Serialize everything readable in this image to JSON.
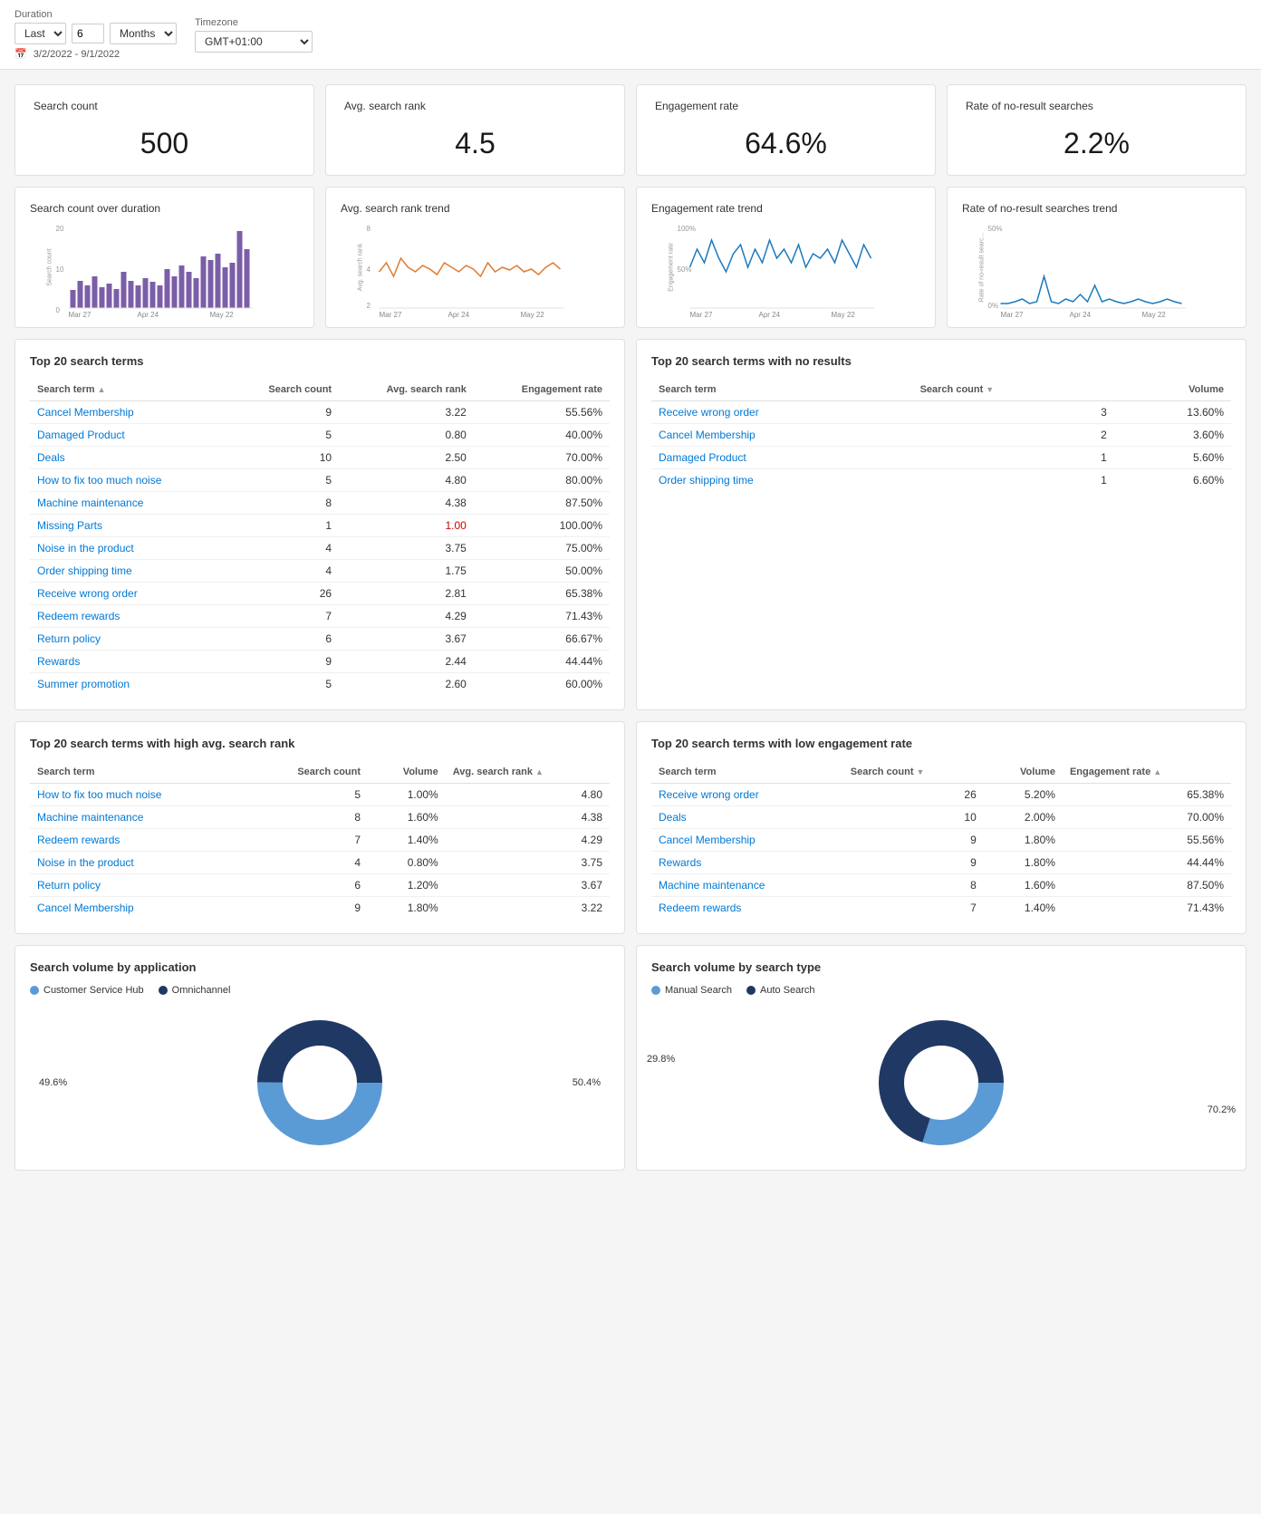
{
  "topBar": {
    "durationLabel": "Duration",
    "durationPreset": "Last",
    "durationValue": "6",
    "durationUnit": "Months",
    "timezoneLabel": "Timezone",
    "timezoneValue": "GMT+01:00",
    "dateRange": "3/2/2022 - 9/1/2022"
  },
  "metrics": [
    {
      "title": "Search count",
      "value": "500"
    },
    {
      "title": "Avg. search rank",
      "value": "4.5"
    },
    {
      "title": "Engagement rate",
      "value": "64.6%"
    },
    {
      "title": "Rate of no-result searches",
      "value": "2.2%"
    }
  ],
  "trendCharts": [
    {
      "title": "Search count over duration",
      "yLabel": "Search count",
      "xLabels": [
        "Mar 27",
        "Apr 24",
        "May 22"
      ]
    },
    {
      "title": "Avg. search rank trend",
      "yLabel": "Avg. search rank",
      "xLabels": [
        "Mar 27",
        "Apr 24",
        "May 22"
      ]
    },
    {
      "title": "Engagement rate trend",
      "yLabel": "Engagement rate",
      "xLabels": [
        "Mar 27",
        "Apr 24",
        "May 22"
      ]
    },
    {
      "title": "Rate of no-result searches trend",
      "yLabel": "Rate of no-result searc...",
      "xLabels": [
        "Mar 27",
        "Apr 24",
        "May 22"
      ]
    }
  ],
  "topSearchTerms": {
    "title": "Top 20 search terms",
    "columns": [
      "Search term",
      "Search count",
      "Avg. search rank",
      "Engagement rate"
    ],
    "rows": [
      [
        "Cancel Membership",
        "9",
        "3.22",
        "55.56%"
      ],
      [
        "Damaged Product",
        "5",
        "0.80",
        "40.00%"
      ],
      [
        "Deals",
        "10",
        "2.50",
        "70.00%"
      ],
      [
        "How to fix too much noise",
        "5",
        "4.80",
        "80.00%"
      ],
      [
        "Machine maintenance",
        "8",
        "4.38",
        "87.50%"
      ],
      [
        "Missing Parts",
        "1",
        "1.00",
        "100.00%"
      ],
      [
        "Noise in the product",
        "4",
        "3.75",
        "75.00%"
      ],
      [
        "Order shipping time",
        "4",
        "1.75",
        "50.00%"
      ],
      [
        "Receive wrong order",
        "26",
        "2.81",
        "65.38%"
      ],
      [
        "Redeem rewards",
        "7",
        "4.29",
        "71.43%"
      ],
      [
        "Return policy",
        "6",
        "3.67",
        "66.67%"
      ],
      [
        "Rewards",
        "9",
        "2.44",
        "44.44%"
      ],
      [
        "Summer promotion",
        "5",
        "2.60",
        "60.00%"
      ]
    ]
  },
  "noResultSearchTerms": {
    "title": "Top 20 search terms with no results",
    "columns": [
      "Search term",
      "Search count",
      "Volume"
    ],
    "rows": [
      [
        "Receive wrong order",
        "3",
        "13.60%"
      ],
      [
        "Cancel Membership",
        "2",
        "3.60%"
      ],
      [
        "Damaged Product",
        "1",
        "5.60%"
      ],
      [
        "Order shipping time",
        "1",
        "6.60%"
      ]
    ]
  },
  "highRankTerms": {
    "title": "Top 20 search terms with high avg. search rank",
    "columns": [
      "Search term",
      "Search count",
      "Volume",
      "Avg. search rank"
    ],
    "rows": [
      [
        "How to fix too much noise",
        "5",
        "1.00%",
        "4.80"
      ],
      [
        "Machine maintenance",
        "8",
        "1.60%",
        "4.38"
      ],
      [
        "Redeem rewards",
        "7",
        "1.40%",
        "4.29"
      ],
      [
        "Noise in the product",
        "4",
        "0.80%",
        "3.75"
      ],
      [
        "Return policy",
        "6",
        "1.20%",
        "3.67"
      ],
      [
        "Cancel Membership",
        "9",
        "1.80%",
        "3.22"
      ]
    ]
  },
  "lowEngagementTerms": {
    "title": "Top 20 search terms with low engagement rate",
    "columns": [
      "Search term",
      "Search count",
      "Volume",
      "Engagement rate"
    ],
    "rows": [
      [
        "Receive wrong order",
        "26",
        "5.20%",
        "65.38%"
      ],
      [
        "Deals",
        "10",
        "2.00%",
        "70.00%"
      ],
      [
        "Cancel Membership",
        "9",
        "1.80%",
        "55.56%"
      ],
      [
        "Rewards",
        "9",
        "1.80%",
        "44.44%"
      ],
      [
        "Machine maintenance",
        "8",
        "1.60%",
        "87.50%"
      ],
      [
        "Redeem rewards",
        "7",
        "1.40%",
        "71.43%"
      ]
    ]
  },
  "donutCharts": [
    {
      "title": "Search volume by application",
      "legend": [
        {
          "label": "Customer Service Hub",
          "color": "#5B9BD5"
        },
        {
          "label": "Omnichannel",
          "color": "#203864"
        }
      ],
      "segments": [
        {
          "value": 49.6,
          "color": "#5B9BD5",
          "label": "49.6%"
        },
        {
          "value": 50.4,
          "color": "#203864",
          "label": "50.4%"
        }
      ]
    },
    {
      "title": "Search volume by search type",
      "legend": [
        {
          "label": "Manual Search",
          "color": "#5B9BD5"
        },
        {
          "label": "Auto Search",
          "color": "#203864"
        }
      ],
      "segments": [
        {
          "value": 29.8,
          "color": "#5B9BD5",
          "label": "29.8%"
        },
        {
          "value": 70.2,
          "color": "#203864",
          "label": "70.2%"
        }
      ]
    }
  ]
}
